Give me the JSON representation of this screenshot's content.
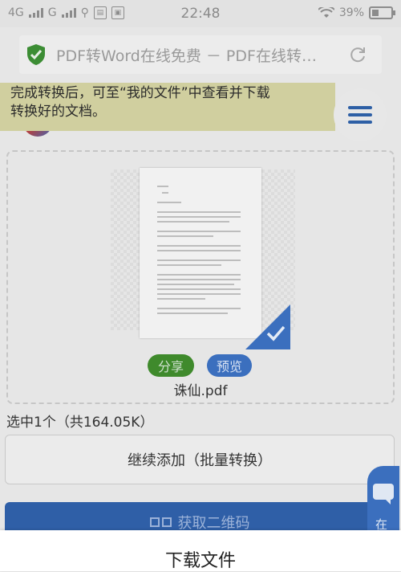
{
  "status_bar": {
    "network1": "4G",
    "network2": "G",
    "time": "22:48",
    "battery": "39%"
  },
  "browser": {
    "page_title": "PDF转Word在线免费 － PDF在线转…"
  },
  "tip_banner": {
    "line1": "完成转换后，可至“我的文件”中查看并下载",
    "line2": "转换好的文档。"
  },
  "file_card": {
    "share_label": "分享",
    "preview_label": "预览",
    "file_name": "诛仙.pdf"
  },
  "selection_info": "选中1个（共164.05K）",
  "continue_button": "继续添加（批量转换）",
  "qr_button": "获取二维码",
  "chat_float": {
    "label": "在"
  },
  "bottom_sheet": {
    "title": "下载文件"
  },
  "colors": {
    "share_green": "#3f8a2c",
    "preview_blue": "#3b6fbe",
    "primary_blue": "#2f5fa7",
    "tip_bg": "#d0cf9f"
  },
  "icons": [
    "signal-icon",
    "usb-icon",
    "wifi-icon",
    "battery-icon",
    "shield-check-icon",
    "reload-icon",
    "menu-icon",
    "check-corner-icon",
    "qr-icon",
    "chat-icon"
  ]
}
